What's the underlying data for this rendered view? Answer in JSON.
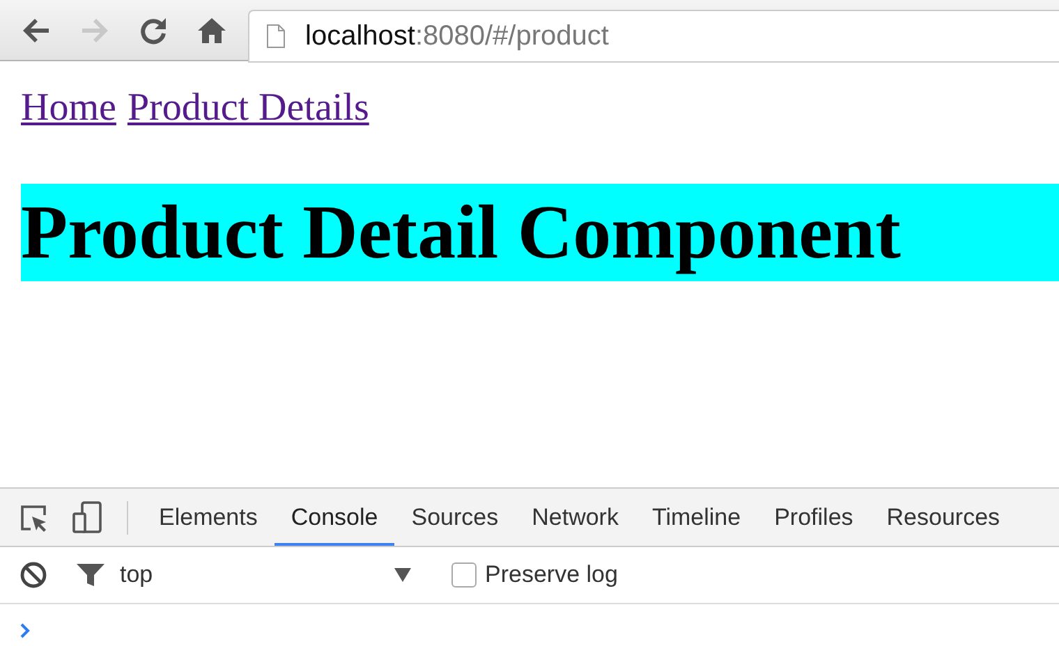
{
  "browser": {
    "nav_buttons": [
      {
        "kind": "back",
        "disabled": false
      },
      {
        "kind": "forward",
        "disabled": true
      },
      {
        "kind": "reload",
        "disabled": false
      },
      {
        "kind": "home",
        "disabled": false
      }
    ],
    "address": {
      "host": "localhost",
      "rest": ":8080/#/product"
    }
  },
  "page": {
    "links": [
      "Home",
      "Product Details"
    ],
    "heading": "Product Detail Component"
  },
  "devtools": {
    "tabs": [
      {
        "label": "Elements",
        "selected": false
      },
      {
        "label": "Console",
        "selected": true
      },
      {
        "label": "Sources",
        "selected": false
      },
      {
        "label": "Network",
        "selected": false
      },
      {
        "label": "Timeline",
        "selected": false
      },
      {
        "label": "Profiles",
        "selected": false
      },
      {
        "label": "Resources",
        "selected": false
      }
    ],
    "context": "top",
    "preserve_log": {
      "label": "Preserve log",
      "checked": false
    }
  }
}
